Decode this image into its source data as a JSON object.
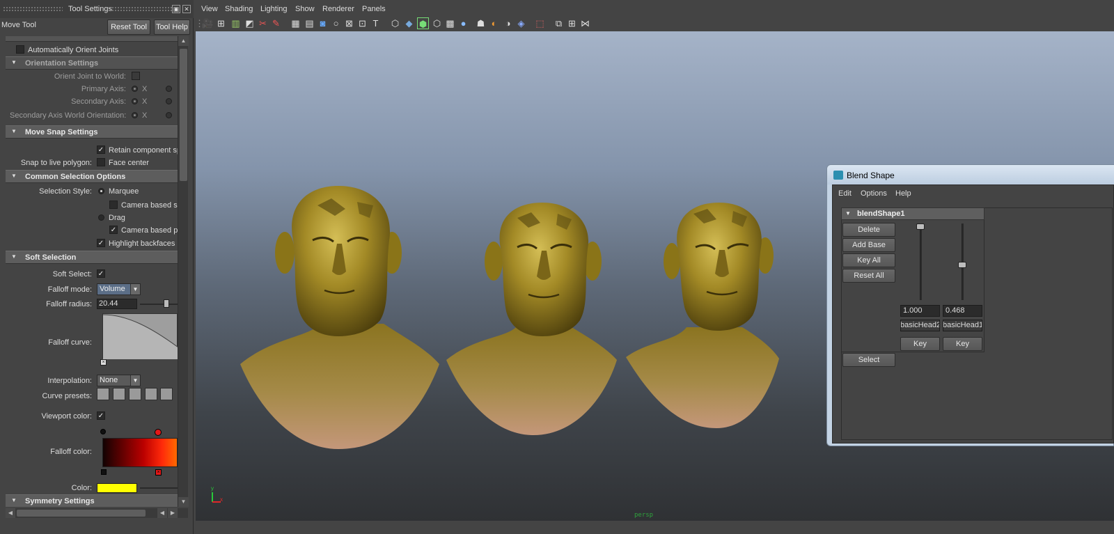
{
  "tool_settings": {
    "window_title": "Tool Settings",
    "tool_name": "Move Tool",
    "reset_button": "Reset Tool",
    "help_button": "Tool Help",
    "auto_orient_joints": "Automatically Orient Joints",
    "orientation": {
      "header": "Orientation Settings",
      "orient_joint_to_world": "Orient Joint to World:",
      "primary_axis": "Primary Axis:",
      "secondary_axis": "Secondary Axis:",
      "secondary_axis_world": "Secondary Axis World Orientation:",
      "axis_x": "X"
    },
    "move_snap": {
      "header": "Move Snap Settings",
      "retain_component": "Retain component sp",
      "snap_live_polygon": "Snap to live polygon:",
      "face_center": "Face center"
    },
    "common_selection": {
      "header": "Common Selection Options",
      "selection_style": "Selection Style:",
      "marquee": "Marquee",
      "camera_based_selection": "Camera based se",
      "drag": "Drag",
      "camera_based_paint": "Camera based pa",
      "highlight_backfaces": "Highlight backfaces"
    },
    "soft_selection": {
      "header": "Soft Selection",
      "soft_select": "Soft Select:",
      "falloff_mode": "Falloff mode:",
      "falloff_mode_value": "Volume",
      "falloff_radius": "Falloff radius:",
      "falloff_radius_value": "20.44",
      "falloff_curve": "Falloff curve:",
      "interpolation": "Interpolation:",
      "interpolation_value": "None",
      "curve_presets": "Curve presets:",
      "viewport_color": "Viewport color:",
      "falloff_color": "Falloff color:",
      "color": "Color:",
      "color_value": "#ffff00"
    },
    "symmetry": {
      "header": "Symmetry Settings"
    }
  },
  "viewport": {
    "menus": [
      "View",
      "Shading",
      "Lighting",
      "Show",
      "Renderer",
      "Panels"
    ],
    "camera_label": "persp",
    "axis_y": "y",
    "axis_x": "x"
  },
  "blend_shape": {
    "window_title": "Blend Shape",
    "menus": [
      "Edit",
      "Options",
      "Help"
    ],
    "node": "blendShape1",
    "buttons": [
      "Delete",
      "Add Base",
      "Key All",
      "Reset All"
    ],
    "targets": [
      {
        "name": "basicHead2",
        "weight": "1.000",
        "key": "Key"
      },
      {
        "name": "basicHead1",
        "weight": "0.468",
        "key": "Key"
      }
    ],
    "select_button": "Select"
  }
}
